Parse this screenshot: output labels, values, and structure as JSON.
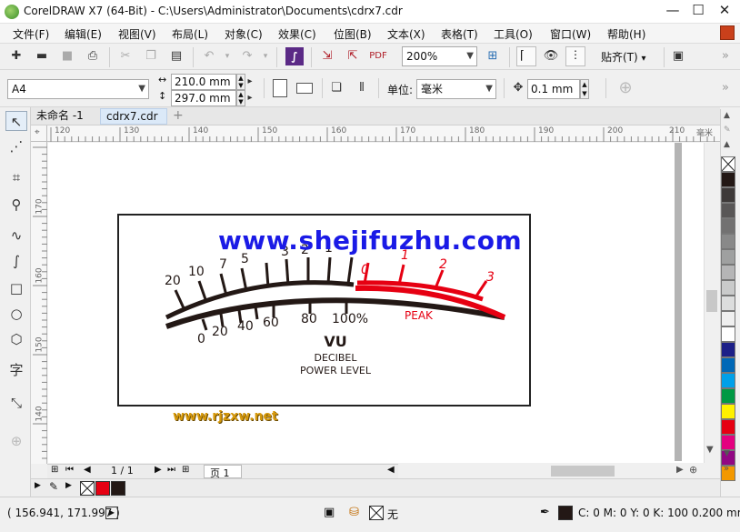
{
  "window": {
    "title": "CorelDRAW X7 (64-Bit) - C:\\Users\\Administrator\\Documents\\cdrx7.cdr",
    "minimize": "—",
    "maximize": "☐",
    "close": "✕"
  },
  "menu": [
    "文件(F)",
    "编辑(E)",
    "视图(V)",
    "布局(L)",
    "对象(C)",
    "效果(C)",
    "位图(B)",
    "文本(X)",
    "表格(T)",
    "工具(O)",
    "窗口(W)",
    "帮助(H)"
  ],
  "standard_toolbar": {
    "zoom": "200%",
    "snap": "贴齐(T)"
  },
  "property_bar": {
    "page_size": "A4",
    "width": "210.0 mm",
    "height": "297.0 mm",
    "units_label": "单位:",
    "units": "毫米",
    "nudge": "0.1 mm"
  },
  "tabs": [
    {
      "label": "未命名 -1",
      "active": false
    },
    {
      "label": "cdrx7.cdr",
      "active": true
    }
  ],
  "rulers": {
    "h_labels": [
      "120",
      "130",
      "140",
      "150",
      "160",
      "170",
      "180",
      "190",
      "200",
      "210"
    ],
    "h_unit": "毫米",
    "v_labels": [
      "170",
      "160",
      "150",
      "140"
    ]
  },
  "artwork": {
    "vu_title": "VU",
    "line2": "DECIBEL",
    "line3": "POWER LEVEL",
    "peak": "PEAK",
    "upper_scale": [
      "20",
      "10",
      "7",
      "5",
      "3",
      "2",
      "1",
      "0",
      "1",
      "2",
      "3"
    ],
    "lower_scale": [
      "0",
      "20",
      "40",
      "60",
      "80",
      "100%"
    ]
  },
  "watermarks": {
    "main": "www.shejifuzhu.com",
    "secondary": "www.rjzxw.net"
  },
  "page_nav": {
    "counter": "1 / 1",
    "page_tab": "页 1"
  },
  "status": {
    "coords": "( 156.941, 171.997 )",
    "fill_none": "无",
    "outline": "C: 0 M: 0 Y: 0 K: 100  0.200 mm"
  },
  "palette_colors": [
    "#231815",
    "#3e3a39",
    "#595757",
    "#727171",
    "#898989",
    "#9fa0a0",
    "#b5b5b6",
    "#c9caca",
    "#dcdddd",
    "#efefef",
    "#ffffff",
    "#1d2088",
    "#0068b7",
    "#00a0e9",
    "#009944",
    "#fff100",
    "#e60012",
    "#e4007f",
    "#920783",
    "#f39800"
  ]
}
